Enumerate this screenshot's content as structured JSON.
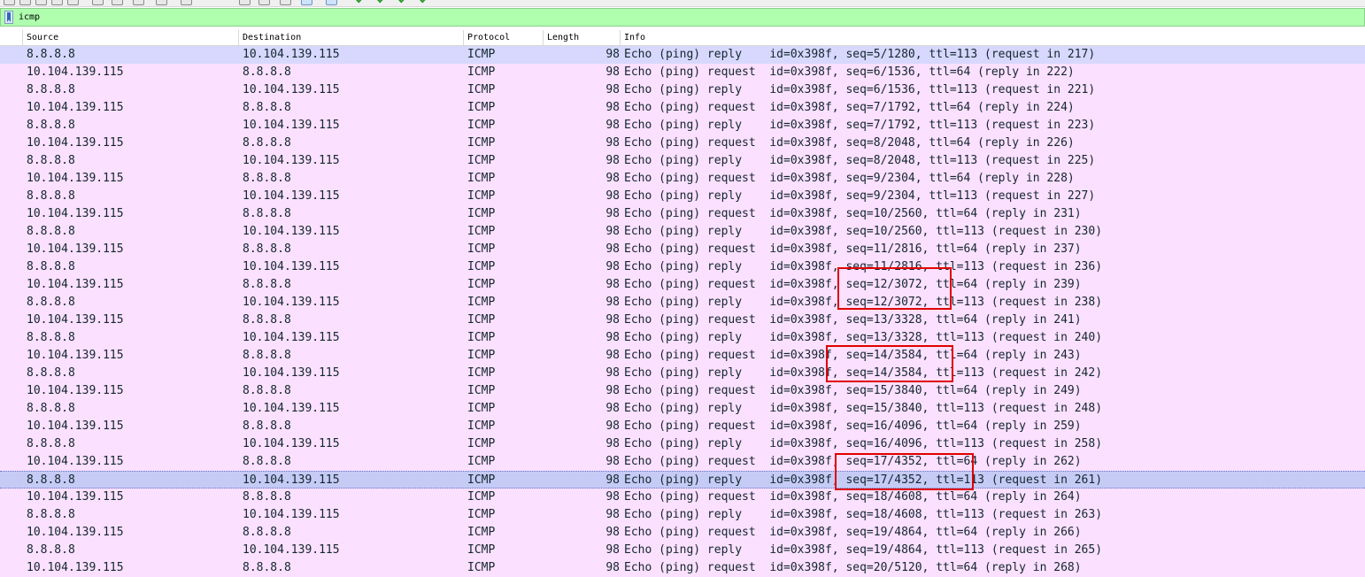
{
  "filter": {
    "value": "icmp"
  },
  "columns": {
    "source": "Source",
    "destination": "Destination",
    "protocol": "Protocol",
    "length": "Length",
    "info": "Info"
  },
  "colors": {
    "row_bg": "#fce0ff",
    "row_highlight": "#d8d8ff",
    "row_selected": "#c6cbf6",
    "filter_bg": "#afffaf",
    "annotation": "#e00000"
  },
  "packets": [
    {
      "src": "8.8.8.8",
      "dst": "10.104.139.115",
      "proto": "ICMP",
      "len": "98",
      "info": "Echo (ping) reply    id=0x398f, seq=5/1280, ttl=113 (request in 217)"
    },
    {
      "src": "10.104.139.115",
      "dst": "8.8.8.8",
      "proto": "ICMP",
      "len": "98",
      "info": "Echo (ping) request  id=0x398f, seq=6/1536, ttl=64 (reply in 222)"
    },
    {
      "src": "8.8.8.8",
      "dst": "10.104.139.115",
      "proto": "ICMP",
      "len": "98",
      "info": "Echo (ping) reply    id=0x398f, seq=6/1536, ttl=113 (request in 221)"
    },
    {
      "src": "10.104.139.115",
      "dst": "8.8.8.8",
      "proto": "ICMP",
      "len": "98",
      "info": "Echo (ping) request  id=0x398f, seq=7/1792, ttl=64 (reply in 224)"
    },
    {
      "src": "8.8.8.8",
      "dst": "10.104.139.115",
      "proto": "ICMP",
      "len": "98",
      "info": "Echo (ping) reply    id=0x398f, seq=7/1792, ttl=113 (request in 223)"
    },
    {
      "src": "10.104.139.115",
      "dst": "8.8.8.8",
      "proto": "ICMP",
      "len": "98",
      "info": "Echo (ping) request  id=0x398f, seq=8/2048, ttl=64 (reply in 226)"
    },
    {
      "src": "8.8.8.8",
      "dst": "10.104.139.115",
      "proto": "ICMP",
      "len": "98",
      "info": "Echo (ping) reply    id=0x398f, seq=8/2048, ttl=113 (request in 225)"
    },
    {
      "src": "10.104.139.115",
      "dst": "8.8.8.8",
      "proto": "ICMP",
      "len": "98",
      "info": "Echo (ping) request  id=0x398f, seq=9/2304, ttl=64 (reply in 228)"
    },
    {
      "src": "8.8.8.8",
      "dst": "10.104.139.115",
      "proto": "ICMP",
      "len": "98",
      "info": "Echo (ping) reply    id=0x398f, seq=9/2304, ttl=113 (request in 227)"
    },
    {
      "src": "10.104.139.115",
      "dst": "8.8.8.8",
      "proto": "ICMP",
      "len": "98",
      "info": "Echo (ping) request  id=0x398f, seq=10/2560, ttl=64 (reply in 231)"
    },
    {
      "src": "8.8.8.8",
      "dst": "10.104.139.115",
      "proto": "ICMP",
      "len": "98",
      "info": "Echo (ping) reply    id=0x398f, seq=10/2560, ttl=113 (request in 230)"
    },
    {
      "src": "10.104.139.115",
      "dst": "8.8.8.8",
      "proto": "ICMP",
      "len": "98",
      "info": "Echo (ping) request  id=0x398f, seq=11/2816, ttl=64 (reply in 237)"
    },
    {
      "src": "8.8.8.8",
      "dst": "10.104.139.115",
      "proto": "ICMP",
      "len": "98",
      "info": "Echo (ping) reply    id=0x398f, seq=11/2816, ttl=113 (request in 236)"
    },
    {
      "src": "10.104.139.115",
      "dst": "8.8.8.8",
      "proto": "ICMP",
      "len": "98",
      "info": "Echo (ping) request  id=0x398f, seq=12/3072, ttl=64 (reply in 239)"
    },
    {
      "src": "8.8.8.8",
      "dst": "10.104.139.115",
      "proto": "ICMP",
      "len": "98",
      "info": "Echo (ping) reply    id=0x398f, seq=12/3072, ttl=113 (request in 238)"
    },
    {
      "src": "10.104.139.115",
      "dst": "8.8.8.8",
      "proto": "ICMP",
      "len": "98",
      "info": "Echo (ping) request  id=0x398f, seq=13/3328, ttl=64 (reply in 241)"
    },
    {
      "src": "8.8.8.8",
      "dst": "10.104.139.115",
      "proto": "ICMP",
      "len": "98",
      "info": "Echo (ping) reply    id=0x398f, seq=13/3328, ttl=113 (request in 240)"
    },
    {
      "src": "10.104.139.115",
      "dst": "8.8.8.8",
      "proto": "ICMP",
      "len": "98",
      "info": "Echo (ping) request  id=0x398f, seq=14/3584, ttl=64 (reply in 243)"
    },
    {
      "src": "8.8.8.8",
      "dst": "10.104.139.115",
      "proto": "ICMP",
      "len": "98",
      "info": "Echo (ping) reply    id=0x398f, seq=14/3584, ttl=113 (request in 242)"
    },
    {
      "src": "10.104.139.115",
      "dst": "8.8.8.8",
      "proto": "ICMP",
      "len": "98",
      "info": "Echo (ping) request  id=0x398f, seq=15/3840, ttl=64 (reply in 249)"
    },
    {
      "src": "8.8.8.8",
      "dst": "10.104.139.115",
      "proto": "ICMP",
      "len": "98",
      "info": "Echo (ping) reply    id=0x398f, seq=15/3840, ttl=113 (request in 248)"
    },
    {
      "src": "10.104.139.115",
      "dst": "8.8.8.8",
      "proto": "ICMP",
      "len": "98",
      "info": "Echo (ping) request  id=0x398f, seq=16/4096, ttl=64 (reply in 259)"
    },
    {
      "src": "8.8.8.8",
      "dst": "10.104.139.115",
      "proto": "ICMP",
      "len": "98",
      "info": "Echo (ping) reply    id=0x398f, seq=16/4096, ttl=113 (request in 258)"
    },
    {
      "src": "10.104.139.115",
      "dst": "8.8.8.8",
      "proto": "ICMP",
      "len": "98",
      "info": "Echo (ping) request  id=0x398f, seq=17/4352, ttl=64 (reply in 262)"
    },
    {
      "src": "8.8.8.8",
      "dst": "10.104.139.115",
      "proto": "ICMP",
      "len": "98",
      "info": "Echo (ping) reply    id=0x398f, seq=17/4352, ttl=113 (request in 261)"
    },
    {
      "src": "10.104.139.115",
      "dst": "8.8.8.8",
      "proto": "ICMP",
      "len": "98",
      "info": "Echo (ping) request  id=0x398f, seq=18/4608, ttl=64 (reply in 264)"
    },
    {
      "src": "8.8.8.8",
      "dst": "10.104.139.115",
      "proto": "ICMP",
      "len": "98",
      "info": "Echo (ping) reply    id=0x398f, seq=18/4608, ttl=113 (request in 263)"
    },
    {
      "src": "10.104.139.115",
      "dst": "8.8.8.8",
      "proto": "ICMP",
      "len": "98",
      "info": "Echo (ping) request  id=0x398f, seq=19/4864, ttl=64 (reply in 266)"
    },
    {
      "src": "8.8.8.8",
      "dst": "10.104.139.115",
      "proto": "ICMP",
      "len": "98",
      "info": "Echo (ping) reply    id=0x398f, seq=19/4864, ttl=113 (request in 265)"
    },
    {
      "src": "10.104.139.115",
      "dst": "8.8.8.8",
      "proto": "ICMP",
      "len": "98",
      "info": "Echo (ping) request  id=0x398f, seq=20/5120, ttl=64 (reply in 268)"
    }
  ]
}
